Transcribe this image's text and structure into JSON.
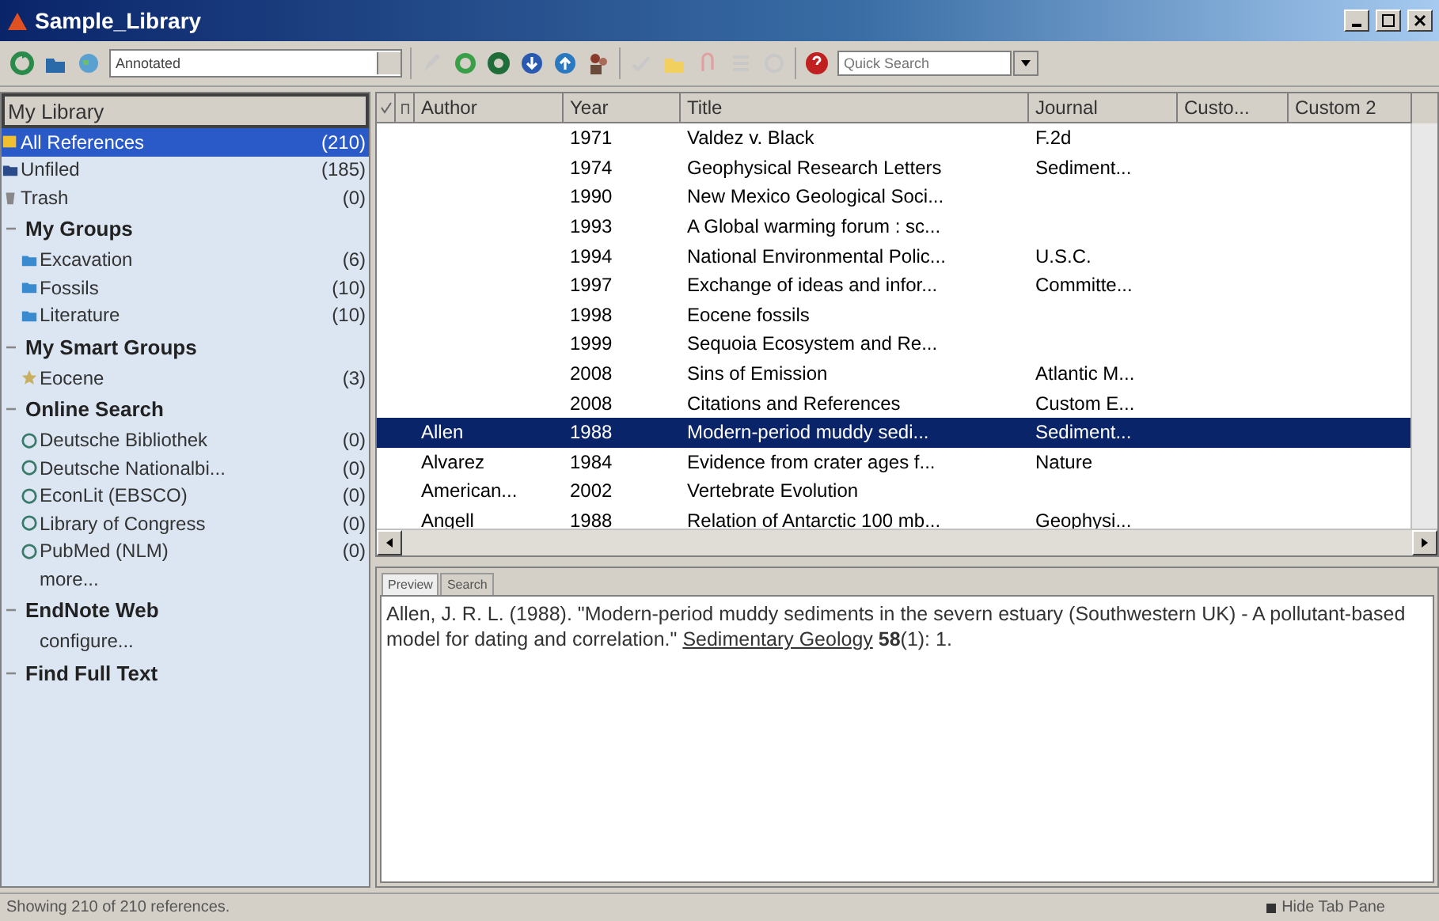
{
  "window": {
    "title": "Sample_Library"
  },
  "toolbar": {
    "style": "Annotated",
    "search": {
      "placeholder": "Quick Search"
    }
  },
  "sidebar": {
    "header": "My Library",
    "items": [
      {
        "label": "All References",
        "count": "(210)",
        "kind": "all",
        "selected": true
      },
      {
        "label": "Unfiled",
        "count": "(185)",
        "kind": "unfiled",
        "selected": false
      },
      {
        "label": "Trash",
        "count": "(0)",
        "kind": "trash",
        "selected": false
      }
    ],
    "sections": [
      {
        "title": "My Groups",
        "expanded": true,
        "items": [
          {
            "label": "Excavation",
            "count": "(6)",
            "kind": "group",
            "selected": false
          },
          {
            "label": "Fossils",
            "count": "(10)",
            "kind": "group",
            "selected": false
          },
          {
            "label": "Literature",
            "count": "(10)",
            "kind": "group",
            "selected": false
          }
        ]
      },
      {
        "title": "My Smart Groups",
        "expanded": true,
        "items": [
          {
            "label": "Eocene",
            "count": "(3)",
            "kind": "smart",
            "selected": false
          }
        ]
      },
      {
        "title": "Online Search",
        "expanded": true,
        "items": [
          {
            "label": "Deutsche Bibliothek",
            "count": "(0)",
            "kind": "online",
            "selected": false
          },
          {
            "label": "Deutsche Nationalbi...",
            "count": "(0)",
            "kind": "online",
            "selected": false
          },
          {
            "label": "EconLit (EBSCO)",
            "count": "(0)",
            "kind": "online",
            "selected": false
          },
          {
            "label": "Library of Congress",
            "count": "(0)",
            "kind": "online",
            "selected": false
          },
          {
            "label": "PubMed (NLM)",
            "count": "(0)",
            "kind": "online",
            "selected": false
          },
          {
            "label": "more...",
            "kind": "link",
            "selected": false
          }
        ]
      },
      {
        "title": "EndNote Web",
        "expanded": true,
        "items": [
          {
            "label": "configure...",
            "kind": "link",
            "selected": false
          }
        ]
      },
      {
        "title": "Find Full Text",
        "expanded": true
      }
    ]
  },
  "table": {
    "columns": [
      "Author",
      "Year",
      "Title",
      "Journal",
      "Custo...",
      "Custom 2"
    ],
    "rows": [
      {
        "year": "1971",
        "title": "Valdez v. Black",
        "journal": "F.2d",
        "selected": false
      },
      {
        "year": "1974",
        "title": "Geophysical Research Letters",
        "journal": "Sediment...",
        "selected": false
      },
      {
        "year": "1990",
        "title": "New Mexico Geological Soci...",
        "selected": false
      },
      {
        "year": "1993",
        "title": "A Global warming forum : sc...",
        "selected": false
      },
      {
        "year": "1994",
        "title": "National Environmental Polic...",
        "journal": "U.S.C.",
        "selected": false
      },
      {
        "year": "1997",
        "title": "Exchange of ideas and infor...",
        "journal": "Committe...",
        "selected": false
      },
      {
        "year": "1998",
        "title": "Eocene fossils",
        "selected": false
      },
      {
        "year": "1999",
        "title": "Sequoia Ecosystem and Re...",
        "selected": false
      },
      {
        "year": "2008",
        "title": "Sins of Emission",
        "journal": "Atlantic M...",
        "selected": false
      },
      {
        "year": "2008",
        "title": "Citations and References",
        "journal": "Custom E...",
        "selected": false
      },
      {
        "author": "Allen",
        "year": "1988",
        "title": "Modern-period muddy sedi...",
        "journal": "Sediment...",
        "selected": true
      },
      {
        "author": "Alvarez",
        "year": "1984",
        "title": "Evidence from crater ages f...",
        "journal": "Nature",
        "selected": false
      },
      {
        "author": "American...",
        "year": "2002",
        "title": "Vertebrate Evolution",
        "selected": false
      },
      {
        "author": "Angell",
        "year": "1988",
        "title": "Relation of Antarctic 100 mb...",
        "journal": "Geophysi...",
        "selected": false
      }
    ]
  },
  "preview": {
    "tabs": [
      {
        "label": "Preview",
        "selected": true
      },
      {
        "label": "Search",
        "selected": false
      }
    ],
    "citation": {
      "before": "Allen, J. R. L. (1988). \"Modern-period muddy sediments in the severn estuary (Southwestern UK) - A pollutant-based model for dating and correlation.\" ",
      "journal": "Sedimentary Geology",
      "after": " **58**(1): 1."
    }
  },
  "status_bar": {
    "text": "Showing 210 of 210 references.",
    "button": "Hide Tab Pane"
  }
}
